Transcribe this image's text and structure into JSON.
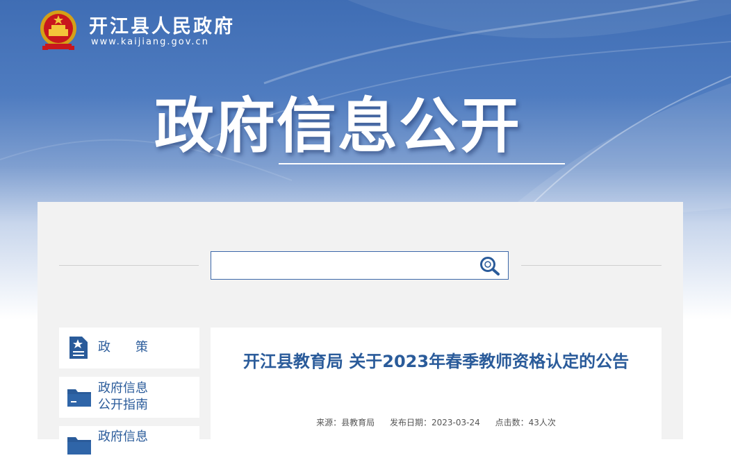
{
  "header": {
    "site_name": "开江县人民政府",
    "site_url": "www.kaijiang.gov.cn"
  },
  "hero": {
    "title": "政府信息公开"
  },
  "search": {
    "value": "",
    "placeholder": ""
  },
  "sidebar": {
    "items": [
      {
        "label": "政　　策",
        "icon": "policy-document-icon"
      },
      {
        "label": "政府信息\n公开指南",
        "icon": "folder-icon"
      },
      {
        "label": "政府信息",
        "icon": "folder-icon"
      }
    ]
  },
  "article": {
    "title": "开江县教育局 关于2023年春季教师资格认定的公告",
    "source": "来源：县教育局",
    "date": "发布日期：2023-03-24",
    "clicks": "点击数：43人次"
  },
  "colors": {
    "primary_blue": "#2a5b9a",
    "panel_gray": "#f2f2f2",
    "banner_blue": "#3f6db4"
  }
}
